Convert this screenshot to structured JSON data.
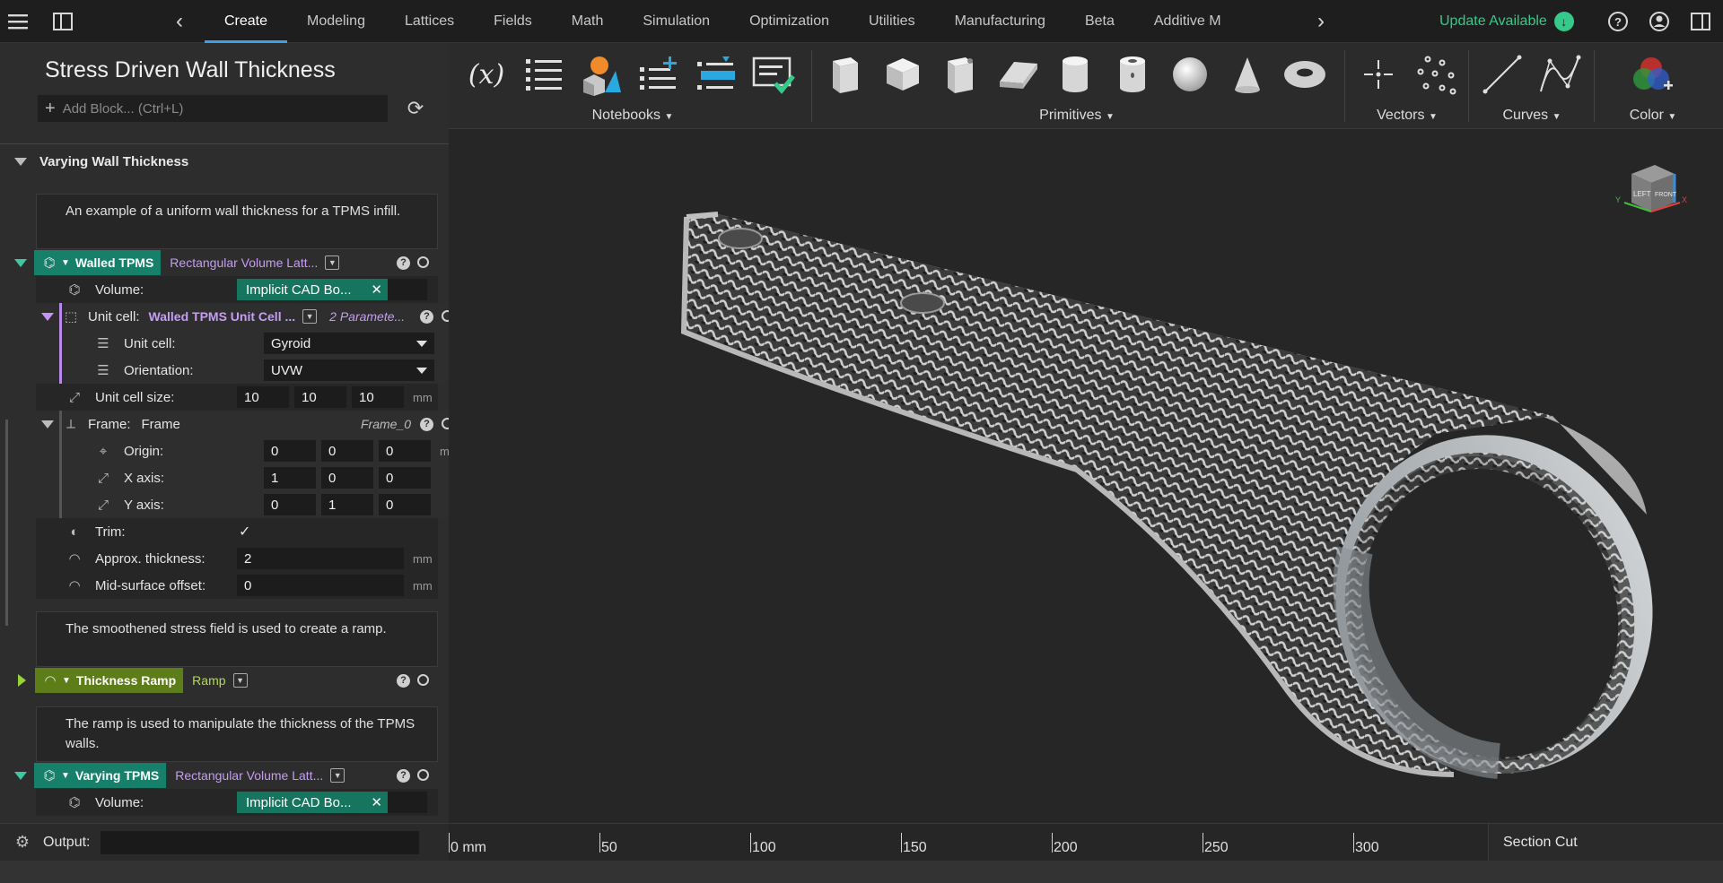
{
  "nav": {
    "tabs": [
      "Create",
      "Modeling",
      "Lattices",
      "Fields",
      "Math",
      "Simulation",
      "Optimization",
      "Utilities",
      "Manufacturing",
      "Beta",
      "Additive M"
    ],
    "active_tab": "Create",
    "update_label": "Update Available"
  },
  "ribbon": {
    "notebooks_label": "Notebooks",
    "primitives_label": "Primitives",
    "vectors_label": "Vectors",
    "curves_label": "Curves",
    "color_label": "Color",
    "variable_symbol": "(x)"
  },
  "notebook": {
    "title": "Stress Driven Wall Thickness",
    "add_block_placeholder": "Add Block... (Ctrl+L)",
    "section_title": "Varying Wall Thickness",
    "note1": "An example of a uniform wall thickness for a TPMS infill.",
    "block1": {
      "name": "Walled TPMS",
      "type": "Rectangular Volume Latt...",
      "volume_label": "Volume:",
      "volume_value": "Implicit CAD Bo...",
      "unit_cell_label": "Unit cell:",
      "unit_cell_type": "Walled TPMS Unit Cell ...",
      "unit_cell_params": "2 Paramete...",
      "uc_unit_cell_label": "Unit cell:",
      "uc_unit_cell_value": "Gyroid",
      "uc_orientation_label": "Orientation:",
      "uc_orientation_value": "UVW",
      "unit_cell_size_label": "Unit cell size:",
      "unit_cell_size": [
        "10",
        "10",
        "10"
      ],
      "unit_mm": "mm",
      "frame_label": "Frame:",
      "frame_type": "Frame",
      "frame_name": "Frame_0",
      "origin_label": "Origin:",
      "origin": [
        "0",
        "0",
        "0"
      ],
      "xaxis_label": "X axis:",
      "xaxis": [
        "1",
        "0",
        "0"
      ],
      "yaxis_label": "Y axis:",
      "yaxis": [
        "0",
        "1",
        "0"
      ],
      "trim_label": "Trim:",
      "trim_check": "✓",
      "thickness_label": "Approx. thickness:",
      "thickness_value": "2",
      "midsurface_label": "Mid-surface offset:",
      "midsurface_value": "0"
    },
    "note2": "The smoothened stress field is used to create a ramp.",
    "block2": {
      "name": "Thickness Ramp",
      "type": "Ramp"
    },
    "note3": "The ramp is used to manipulate the thickness of the TPMS walls.",
    "block3": {
      "name": "Varying TPMS",
      "type": "Rectangular Volume Latt...",
      "volume_label": "Volume:",
      "volume_value": "Implicit CAD Bo..."
    }
  },
  "viewcube": {
    "left": "LEFT",
    "front": "FRONT",
    "x": "X",
    "y": "Y"
  },
  "bottom": {
    "output_label": "Output:",
    "ruler_labels": [
      "0 mm",
      "50",
      "100",
      "150",
      "200",
      "250",
      "300"
    ],
    "section_cut_label": "Section Cut"
  }
}
